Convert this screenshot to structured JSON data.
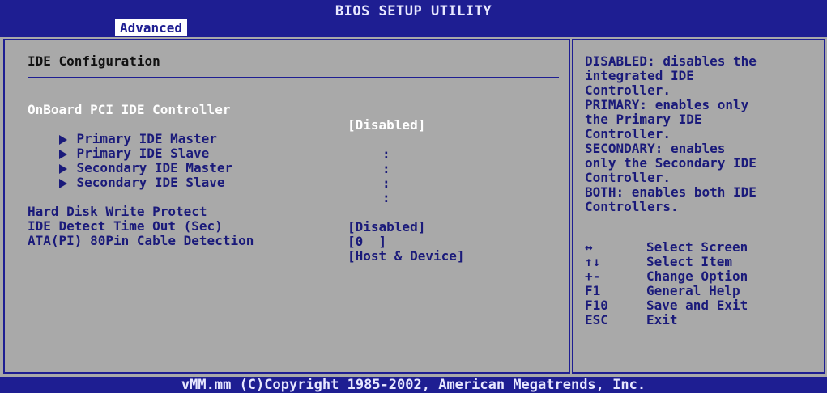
{
  "header": {
    "title": "BIOS SETUP UTILITY",
    "active_tab": "Advanced"
  },
  "page": {
    "section_title": "IDE Configuration"
  },
  "settings": {
    "onboard": {
      "label": "OnBoard PCI IDE Controller",
      "value": "[Disabled]"
    },
    "submenus": [
      {
        "label": "Primary IDE Master",
        "value": ":"
      },
      {
        "label": "Primary IDE Slave",
        "value": ":"
      },
      {
        "label": "Secondary IDE Master",
        "value": ":"
      },
      {
        "label": "Secondary IDE Slave",
        "value": ":"
      }
    ],
    "hd_write": {
      "label": "Hard Disk Write Protect",
      "value": "[Disabled]"
    },
    "ide_timeout": {
      "label": "IDE Detect Time Out (Sec)",
      "value": "[0  ]"
    },
    "ata_cable": {
      "label": "ATA(PI) 80Pin Cable Detection",
      "value": "[Host & Device]"
    }
  },
  "help": {
    "lines": [
      "DISABLED: disables the",
      "integrated IDE",
      "Controller.",
      "PRIMARY: enables only",
      "the Primary IDE",
      "Controller.",
      "SECONDARY: enables",
      "only the Secondary IDE",
      "Controller.",
      "BOTH: enables both IDE",
      "Controllers."
    ],
    "keys": [
      {
        "key": "↔",
        "action": "Select Screen"
      },
      {
        "key": "↑↓",
        "action": "Select Item"
      },
      {
        "key": "+-",
        "action": "Change Option"
      },
      {
        "key": "F1",
        "action": "General Help"
      },
      {
        "key": "F10",
        "action": "Save and Exit"
      },
      {
        "key": "ESC",
        "action": "Exit"
      }
    ]
  },
  "footer": {
    "text": "vMM.mm (C)Copyright 1985-2002, American Megatrends, Inc."
  },
  "colors": {
    "bar": "#1e1e92",
    "background": "#a9a9a9",
    "text": "#1a1a7a",
    "selected": "#ffffff"
  }
}
